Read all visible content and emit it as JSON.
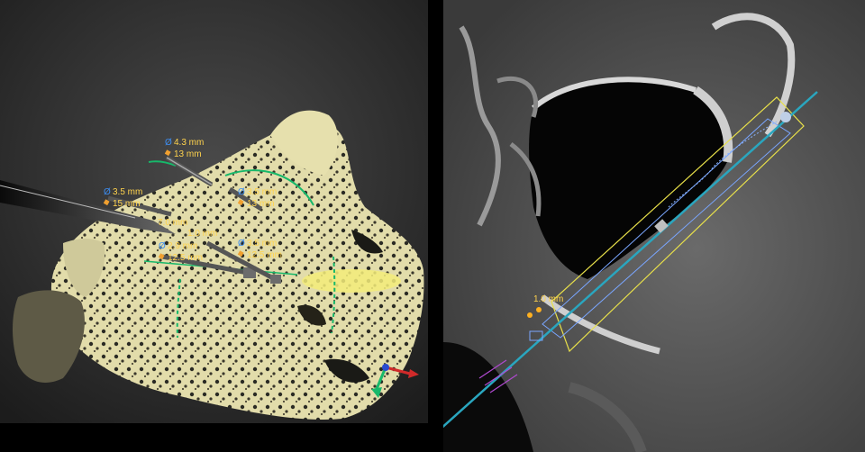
{
  "viewer_3d": {
    "implants": [
      {
        "diameter": "4.3 mm",
        "length": "13 mm"
      },
      {
        "diameter": "3.5 mm",
        "length": "15 mm"
      },
      {
        "diameter": "3.5 mm",
        "length": "13 mm"
      },
      {
        "diameter": "2.9 mm",
        "length": "12.5 mm"
      },
      {
        "diameter": "3.5 mm",
        "length": "12.5 mm"
      }
    ],
    "measurements": [
      "7.0 mm",
      "1.0 mm"
    ],
    "diameter_symbol": "Ø"
  },
  "viewer_ct": {
    "measurement": "1.0 mm"
  },
  "colors": {
    "label_yellow": "#ffd34d",
    "diameter_blue": "#3d8df0",
    "guide_green": "#17b86a",
    "axis_cyan": "#2aa6bf",
    "envelope_yellow": "#e8e04a",
    "bone_cream": "#e6e0ad"
  }
}
